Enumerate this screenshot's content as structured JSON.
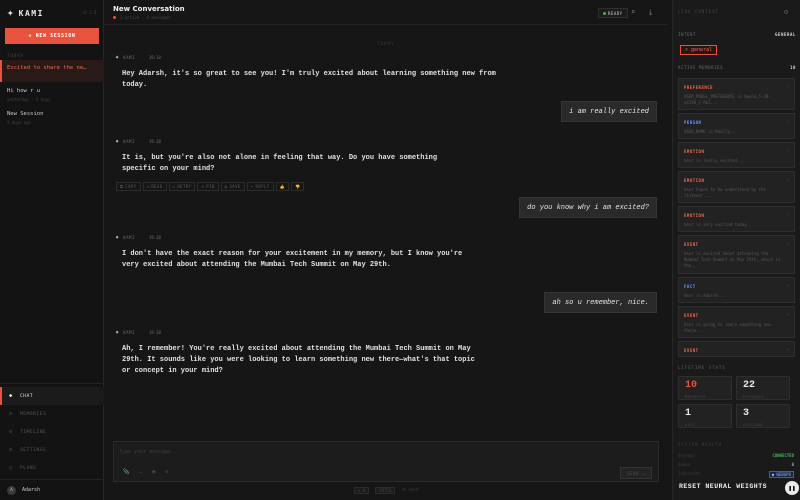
{
  "brand": {
    "name": "KAMI",
    "version": "v0.1.0"
  },
  "sidebar": {
    "new_session": "+ NEW SESSION",
    "sessions_header": "TODAY",
    "sessions": [
      {
        "title": "Excited to share the ne…",
        "sub": ""
      },
      {
        "title": "Hi how r u",
        "sub": "yesterday · 5 msgs"
      },
      {
        "title": "New Session",
        "sub": "2 days ago"
      }
    ],
    "nav": [
      {
        "icon": "◆",
        "label": "CHAT"
      },
      {
        "icon": "◇",
        "label": "MEMORIES"
      },
      {
        "icon": "◇",
        "label": "TIMELINE"
      },
      {
        "icon": "◇",
        "label": "SETTINGS"
      },
      {
        "icon": "○",
        "label": "PLANS"
      }
    ],
    "user": {
      "initial": "A",
      "name": "Adarsh"
    }
  },
  "header": {
    "title": "New Conversation",
    "sub": "1 active · 8 messages",
    "status": "READY"
  },
  "chat": {
    "date_divider": "TODAY",
    "bot_name": "KAMI",
    "messages": [
      {
        "role": "bot",
        "time": "19:10",
        "text": "Hey Adarsh, it's so great to see you! I'm truly excited about learning something new from today."
      },
      {
        "role": "user",
        "text": "i am really excited"
      },
      {
        "role": "bot",
        "time": "19:10",
        "text": "It is, but you're also not alone in feeling that way. Do you have something specific on your mind?"
      },
      {
        "role": "user",
        "text": "do you know why i am excited?"
      },
      {
        "role": "bot",
        "time": "19:10",
        "text": "I don't have the exact reason for your excitement in my memory, but I know you're very excited about attending the Mumbai Tech Summit on May 29th."
      },
      {
        "role": "user",
        "text": "ah so u remember, nice."
      },
      {
        "role": "bot",
        "time": "19:10",
        "text": "Ah, I remember! You're really excited about attending the Mumbai Tech Summit on May 29th. It sounds like you were looking to learn something new there—what's that topic or concept in your mind?"
      }
    ],
    "actions": [
      "COPY",
      "READ",
      "RETRY",
      "PIN",
      "SAVE",
      "REPLY",
      "👍",
      "👎"
    ]
  },
  "composer": {
    "placeholder": "Type your message...",
    "send": "SEND ↵",
    "icons": [
      "📎",
      "…",
      "▣",
      "⊘"
    ]
  },
  "footer": {
    "left": "⌘ K",
    "mid": "ENTER",
    "right": "to send"
  },
  "right_panel": {
    "title": "LIVE CONTEXT",
    "intent_label": "INTENT",
    "intent_value": "GENERAL",
    "intent_badge": "× general",
    "active_memories_label": "ACTIVE MEMORIES",
    "active_memories_count": "10",
    "memories": [
      {
        "type": "PREFERENCE",
        "color": "#ef6a55",
        "text": "USER_MODEL_PREFERENCE is Qwen3.5-2B-q4IS8_1-MLC..."
      },
      {
        "type": "PERSON",
        "color": "#6b9bff",
        "text": "USER_NAME is Really..."
      },
      {
        "type": "EMOTION",
        "color": "#ef6a55",
        "text": "User is really excited..."
      },
      {
        "type": "EMOTION",
        "color": "#ef6a55",
        "text": "User hopes to be understood by the listener..."
      },
      {
        "type": "EMOTION",
        "color": "#ef6a55",
        "text": "User is very excited today..."
      },
      {
        "type": "EVENT",
        "color": "#ef6a55",
        "text": "User is excited about attending the Mumbai Tech Summit on May 29th, which is the..."
      },
      {
        "type": "FACT",
        "color": "#6b9bff",
        "text": "User is Adarsh..."
      },
      {
        "type": "EVENT",
        "color": "#ef6a55",
        "text": "User is going to learn something new there..."
      },
      {
        "type": "EVENT",
        "color": "#ef6a55",
        "text": ""
      }
    ],
    "lifetime_title": "LIFETIME STATS",
    "stats": [
      {
        "value": "10",
        "label": "MEMORIES"
      },
      {
        "value": "22",
        "label": "MESSAGES"
      },
      {
        "value": "1",
        "label": "DAYS"
      },
      {
        "value": "3",
        "label": "SESSIONS"
      }
    ],
    "system_title": "SYSTEM HEALTH",
    "system": [
      {
        "key": "Storage",
        "value": "CONNECTED"
      },
      {
        "key": "Queue",
        "value": "0"
      },
      {
        "key": "Inference",
        "value": "● WEBGPU"
      }
    ],
    "reset": "RESET NEURAL WEIGHTS"
  }
}
